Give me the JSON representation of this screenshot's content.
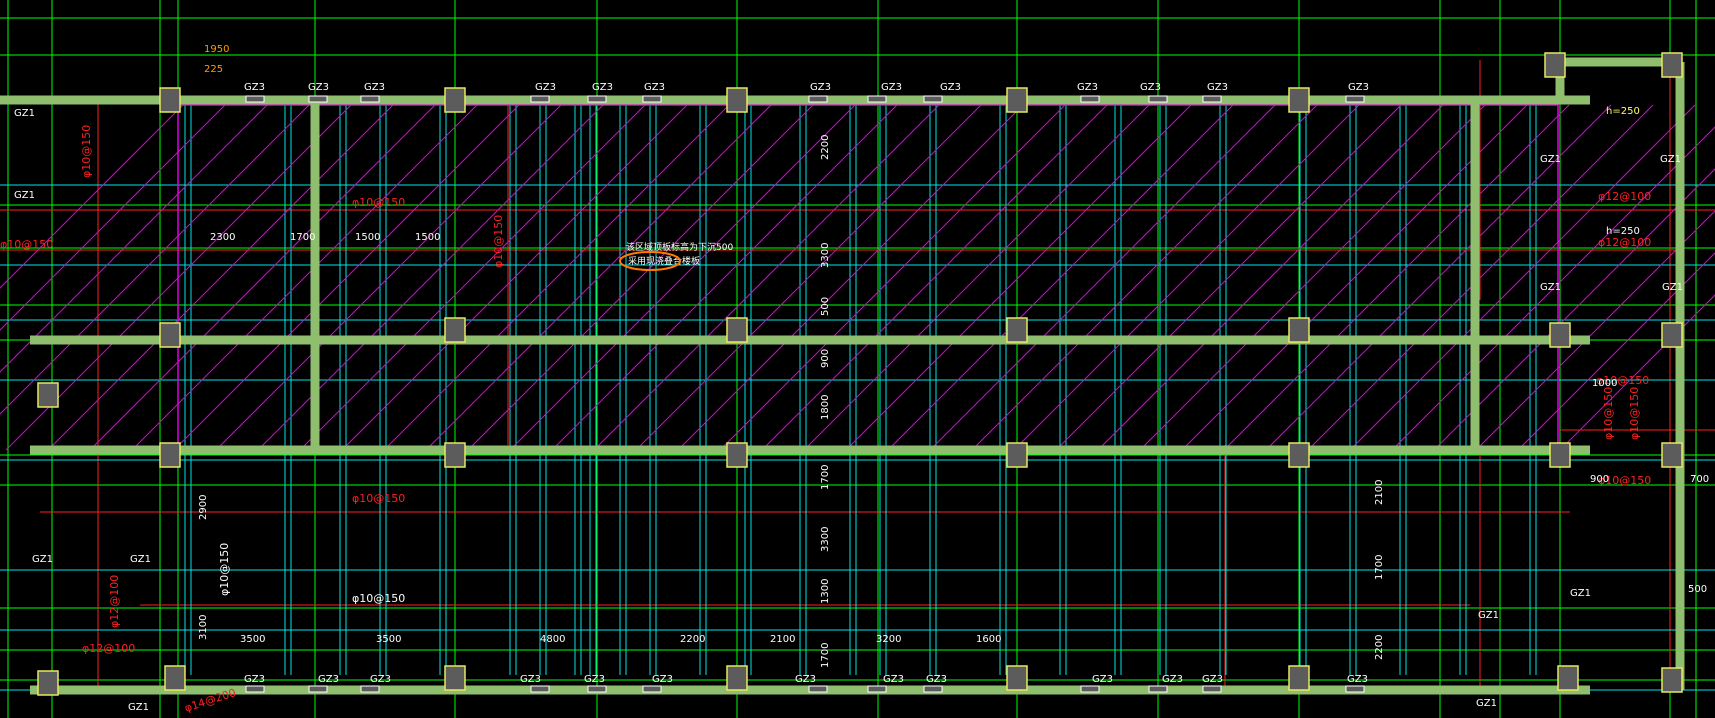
{
  "drawing": {
    "background": "#000000",
    "colors": {
      "grid": "#00ff00",
      "beam": "#8fbf6e",
      "wall": "#00e5e5",
      "hatch": "#e000e0",
      "rebar": "#ff2020",
      "column_fill": "#5c5c5c",
      "column_edge": "#e8e860",
      "text": "#ffffff",
      "note_circle": "#ff7a00"
    },
    "labels": {
      "gz1": "GZ1",
      "gz3": "GZ3",
      "h250": "h=250",
      "rebar_150": "φ10@150",
      "rebar_12": "φ12@100",
      "rebar_bottom": "φ14@200",
      "dims": [
        "1950",
        "225",
        "2300",
        "1700",
        "1500",
        "1500",
        "2200",
        "3300",
        "500",
        "900",
        "1800",
        "2900",
        "3100",
        "1700",
        "3300",
        "1300",
        "1700",
        "3500",
        "3500",
        "4800",
        "2200",
        "2100",
        "3200",
        "1600",
        "2100",
        "1700",
        "2200",
        "1000",
        "900",
        "700",
        "500"
      ],
      "note_line1": "该区域顶板标高为下沉500",
      "note_line2": "采用现浇叠合楼板"
    }
  }
}
